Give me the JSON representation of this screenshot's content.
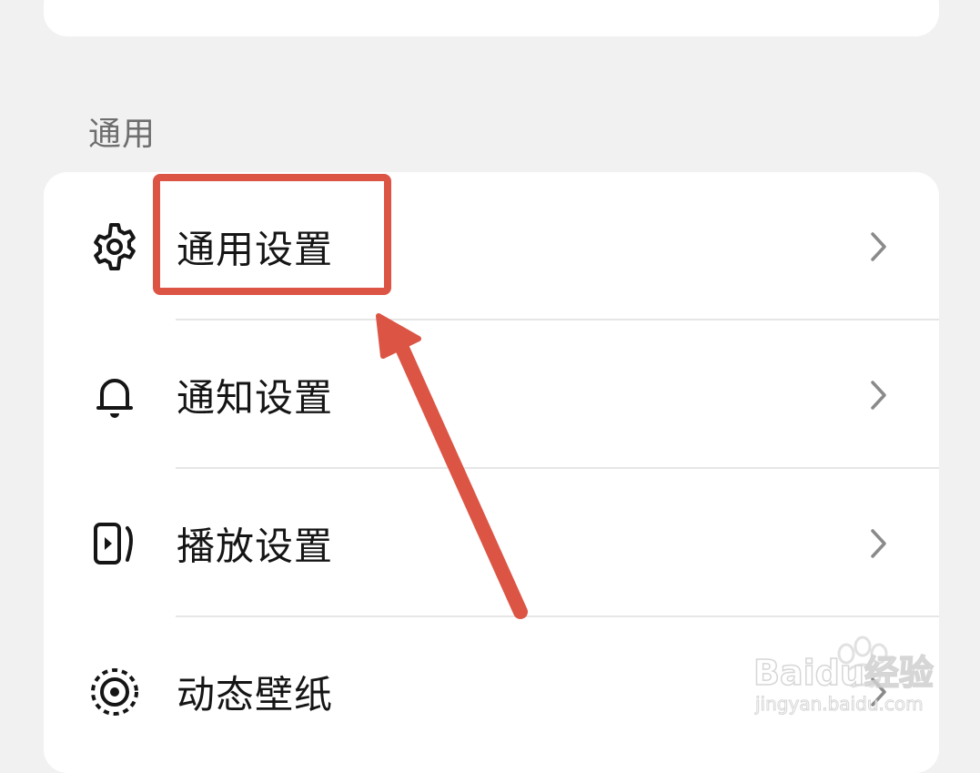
{
  "section": {
    "title": "通用"
  },
  "settings_list": [
    {
      "label": "通用设置",
      "icon": "gear-icon"
    },
    {
      "label": "通知设置",
      "icon": "bell-icon"
    },
    {
      "label": "播放设置",
      "icon": "playback-icon"
    },
    {
      "label": "动态壁纸",
      "icon": "live-wallpaper-icon"
    }
  ],
  "annotation": {
    "color": "#dc5444"
  },
  "watermark": {
    "brand": "Baidu经验",
    "url": "jingyan.baidu.com"
  }
}
